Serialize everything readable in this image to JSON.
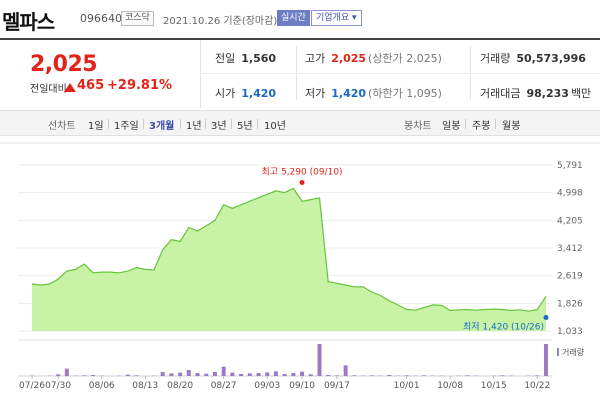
{
  "header": {
    "name": "멜파스",
    "code": "096640",
    "market": "코스닥",
    "date": "2021.10.26  기준(장마감)",
    "realtime": "실시간",
    "company_info": "기업개요 ▾"
  },
  "price": {
    "current": "2,025",
    "change_label": "전일대비",
    "change_amount": "465",
    "change_rate": "+29.81%"
  },
  "stats": {
    "prev_close": {
      "label": "전일",
      "value": "1,560"
    },
    "high": {
      "label": "고가",
      "value": "2,025",
      "sub": "(상한가 2,025)"
    },
    "volume": {
      "label": "거래량",
      "value": "50,573,996"
    },
    "open": {
      "label": "시가",
      "value": "1,420"
    },
    "low": {
      "label": "저가",
      "value": "1,420",
      "sub": "(하한가 1,095)"
    },
    "trade_value": {
      "label": "거래대금",
      "value": "98,233",
      "unit": "백만"
    }
  },
  "period_bar": {
    "line_label": "선차트",
    "periods": [
      "1일",
      "1주일",
      "3개월",
      "1년",
      "3년",
      "5년",
      "10년"
    ],
    "active_period": "3개월",
    "candle_label": "봉차트",
    "candles": [
      "일봉",
      "주봉",
      "월봉"
    ]
  },
  "colors": {
    "up": "#e2231a",
    "down": "#1b6ac9",
    "area_fill": "#c8f2a6",
    "area_line": "#66c43a",
    "volume_bar": "#9c7bc4"
  },
  "chart_data": {
    "type": "area",
    "y_ticks": [
      "5,791",
      "4,998",
      "4,205",
      "3,412",
      "2,619",
      "1,826",
      "1,033"
    ],
    "ylim": [
      1033,
      5791
    ],
    "x_tick_labels": [
      "07/26",
      "07/30",
      "08/06",
      "08/13",
      "08/20",
      "08/27",
      "09/03",
      "09/10",
      "09/17",
      "10/01",
      "10/08",
      "10/15",
      "10/22"
    ],
    "x_tick_index": [
      0,
      3,
      8,
      13,
      17,
      22,
      27,
      31,
      35,
      43,
      48,
      53,
      58
    ],
    "values": [
      2380,
      2350,
      2380,
      2520,
      2750,
      2800,
      2950,
      2700,
      2720,
      2720,
      2700,
      2750,
      2850,
      2800,
      2780,
      3360,
      3650,
      3600,
      4000,
      3900,
      4050,
      4200,
      4650,
      4550,
      4650,
      4750,
      4850,
      4950,
      5050,
      5000,
      5120,
      4750,
      4800,
      4850,
      2450,
      2400,
      2350,
      2300,
      2300,
      2150,
      2050,
      1900,
      1780,
      1650,
      1630,
      1700,
      1780,
      1770,
      1620,
      1640,
      1650,
      1630,
      1650,
      1660,
      1650,
      1620,
      1640,
      1600,
      1650,
      2025
    ],
    "volumes": [
      1,
      0,
      1,
      5,
      22,
      1,
      2,
      3,
      1,
      0,
      1,
      4,
      2,
      0,
      1,
      12,
      8,
      10,
      18,
      9,
      7,
      12,
      28,
      10,
      6,
      8,
      9,
      11,
      14,
      6,
      9,
      13,
      5,
      96,
      3,
      2,
      32,
      2,
      1,
      2,
      1,
      3,
      1,
      2,
      1,
      2,
      1,
      1,
      0,
      1,
      2,
      1,
      0,
      1,
      2,
      1,
      0,
      1,
      2,
      96
    ],
    "high_annotation": {
      "text": "최고 5,290 (09/10)",
      "index": 31,
      "value": 5290
    },
    "low_annotation": {
      "text": "최저 1,420 (10/26)",
      "index": 59,
      "value": 1420
    },
    "volume_label": "거래량"
  }
}
